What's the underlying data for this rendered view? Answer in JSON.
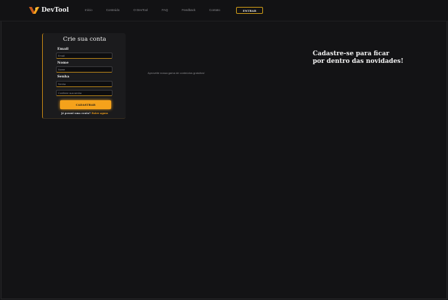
{
  "brand": {
    "name": "DevTool",
    "accent": "#f5a21b"
  },
  "nav": {
    "items": [
      "Início",
      "Conteúdo",
      "O DevTool",
      "FAQ",
      "Feedback",
      "Contato"
    ],
    "login_label": "ENTRAR"
  },
  "form": {
    "title": "Crie sua conta",
    "email_label": "Email",
    "email_placeholder": "Email",
    "name_label": "Nome",
    "name_placeholder": "Nome",
    "password_label": "Senha",
    "password_placeholder": "Senha",
    "confirm_placeholder": "Confirme sua senha",
    "submit_label": "CADASTRAR",
    "have_account_text": "Já possui uma conta?",
    "login_link": "Entre agora"
  },
  "hero": {
    "tagline": "Aproveite nossa gama de conteúdos gratuitos!",
    "headline_line1": "Cadastre-se para ficar",
    "headline_line2": "por dentro das novidades!"
  }
}
